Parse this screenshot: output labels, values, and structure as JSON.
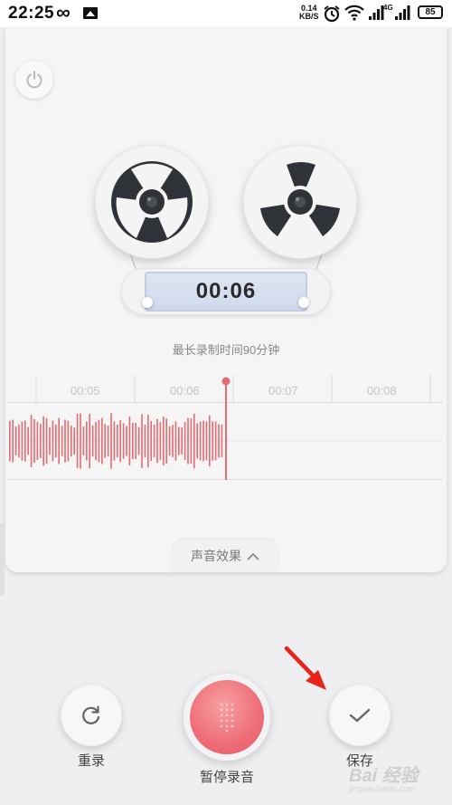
{
  "status_bar": {
    "time": "22:25",
    "infinity_glyph": "∞",
    "net_speed_value": "0.14",
    "net_speed_unit": "KB/S",
    "network_type": "4G",
    "battery": "85",
    "icons": [
      "gallery-icon",
      "alarm-icon",
      "wifi-icon",
      "signal-icon",
      "signal-icon",
      "battery-icon"
    ]
  },
  "recorder": {
    "elapsed_time": "00:06",
    "max_duration_note": "最长录制时间90分钟",
    "timeline_labels": [
      "00:05",
      "00:06",
      "00:07",
      "00:08"
    ],
    "effects_label": "声音效果",
    "accent_color": "#e36b72"
  },
  "controls": {
    "rerecord_label": "重录",
    "pause_label": "暂停录音",
    "save_label": "保存"
  },
  "watermark": {
    "text": "Bai 经验",
    "url": "jingyan.baidu.com"
  }
}
